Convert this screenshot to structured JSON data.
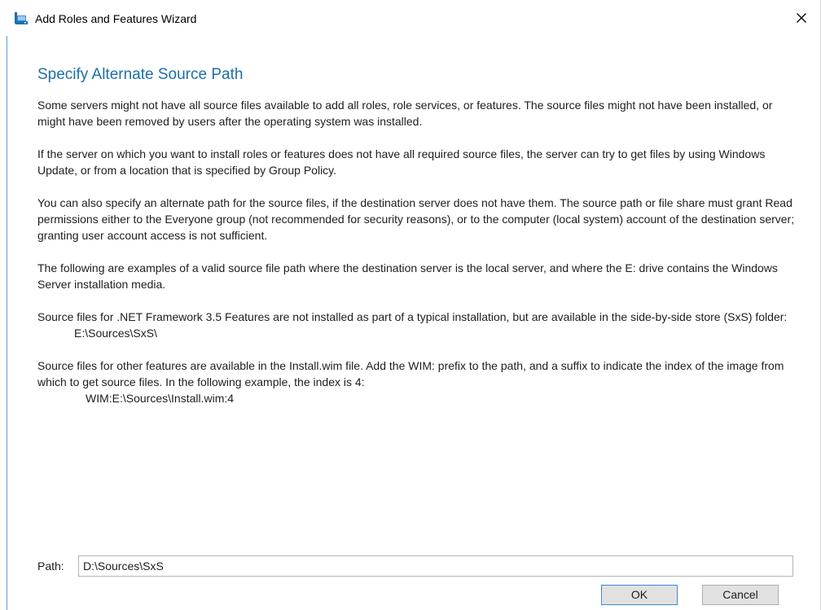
{
  "window": {
    "title": "Add Roles and Features Wizard",
    "close_glyph": "✕"
  },
  "content": {
    "heading": "Specify Alternate Source Path",
    "para1": "Some servers might not have all source files available to add all roles, role services, or features. The source files might not have been installed, or might have been removed by users after the operating system was installed.",
    "para2": "If the server on which you want to install roles or features does not have all required source files, the server can try to get files by using Windows Update, or from a location that is specified by Group Policy.",
    "para3": "You can also specify an alternate path for the source files, if the destination server does not have them. The source path or file share must grant Read permissions either to the Everyone group (not recommended for security reasons), or to the computer (local system) account of the destination server; granting user account access is not sufficient.",
    "para4": "The following are examples of a valid source file path where the destination server is the local server, and where the E: drive contains the Windows Server installation media.",
    "para5": "Source files for .NET Framework 3.5 Features are not installed as part of a typical installation, but are available in the side-by-side store (SxS) folder:",
    "example1": "E:\\Sources\\SxS\\",
    "para6": "Source files for other features are available in the Install.wim file. Add the WIM: prefix to the path, and a suffix to indicate the index of the image from which to get source files. In the following example, the index is 4:",
    "example2": "WIM:E:\\Sources\\Install.wim:4"
  },
  "path": {
    "label": "Path:",
    "value": "D:\\Sources\\SxS"
  },
  "buttons": {
    "ok_label": "OK",
    "cancel_label": "Cancel"
  },
  "icons": {
    "app": "server-manager-icon",
    "close": "close-icon"
  },
  "colors": {
    "heading": "#1e6fa8",
    "accent_border": "#5a9bd5",
    "ok_border": "#3c8ad4"
  }
}
